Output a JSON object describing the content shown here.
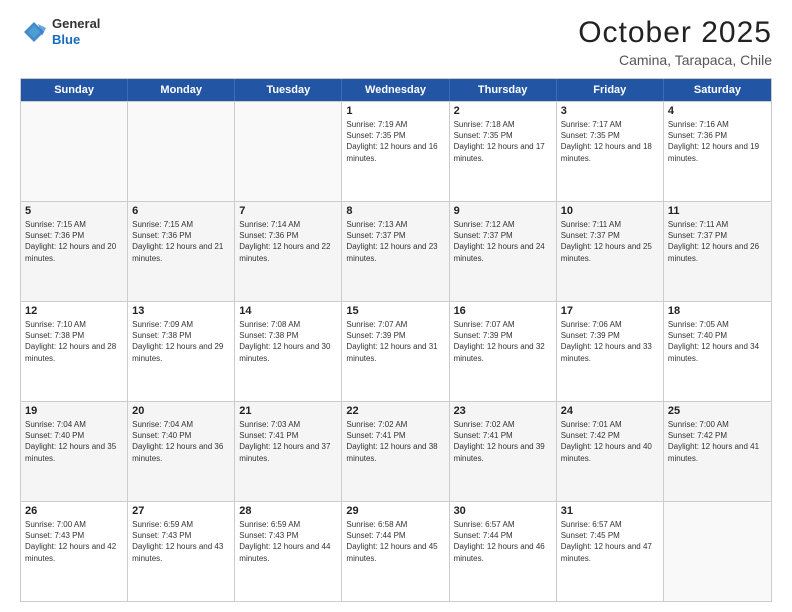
{
  "header": {
    "logo_general": "General",
    "logo_blue": "Blue",
    "month": "October 2025",
    "location": "Camina, Tarapaca, Chile"
  },
  "days_of_week": [
    "Sunday",
    "Monday",
    "Tuesday",
    "Wednesday",
    "Thursday",
    "Friday",
    "Saturday"
  ],
  "rows": [
    [
      {
        "day": "",
        "info": ""
      },
      {
        "day": "",
        "info": ""
      },
      {
        "day": "",
        "info": ""
      },
      {
        "day": "1",
        "info": "Sunrise: 7:19 AM\nSunset: 7:35 PM\nDaylight: 12 hours and 16 minutes."
      },
      {
        "day": "2",
        "info": "Sunrise: 7:18 AM\nSunset: 7:35 PM\nDaylight: 12 hours and 17 minutes."
      },
      {
        "day": "3",
        "info": "Sunrise: 7:17 AM\nSunset: 7:35 PM\nDaylight: 12 hours and 18 minutes."
      },
      {
        "day": "4",
        "info": "Sunrise: 7:16 AM\nSunset: 7:36 PM\nDaylight: 12 hours and 19 minutes."
      }
    ],
    [
      {
        "day": "5",
        "info": "Sunrise: 7:15 AM\nSunset: 7:36 PM\nDaylight: 12 hours and 20 minutes."
      },
      {
        "day": "6",
        "info": "Sunrise: 7:15 AM\nSunset: 7:36 PM\nDaylight: 12 hours and 21 minutes."
      },
      {
        "day": "7",
        "info": "Sunrise: 7:14 AM\nSunset: 7:36 PM\nDaylight: 12 hours and 22 minutes."
      },
      {
        "day": "8",
        "info": "Sunrise: 7:13 AM\nSunset: 7:37 PM\nDaylight: 12 hours and 23 minutes."
      },
      {
        "day": "9",
        "info": "Sunrise: 7:12 AM\nSunset: 7:37 PM\nDaylight: 12 hours and 24 minutes."
      },
      {
        "day": "10",
        "info": "Sunrise: 7:11 AM\nSunset: 7:37 PM\nDaylight: 12 hours and 25 minutes."
      },
      {
        "day": "11",
        "info": "Sunrise: 7:11 AM\nSunset: 7:37 PM\nDaylight: 12 hours and 26 minutes."
      }
    ],
    [
      {
        "day": "12",
        "info": "Sunrise: 7:10 AM\nSunset: 7:38 PM\nDaylight: 12 hours and 28 minutes."
      },
      {
        "day": "13",
        "info": "Sunrise: 7:09 AM\nSunset: 7:38 PM\nDaylight: 12 hours and 29 minutes."
      },
      {
        "day": "14",
        "info": "Sunrise: 7:08 AM\nSunset: 7:38 PM\nDaylight: 12 hours and 30 minutes."
      },
      {
        "day": "15",
        "info": "Sunrise: 7:07 AM\nSunset: 7:39 PM\nDaylight: 12 hours and 31 minutes."
      },
      {
        "day": "16",
        "info": "Sunrise: 7:07 AM\nSunset: 7:39 PM\nDaylight: 12 hours and 32 minutes."
      },
      {
        "day": "17",
        "info": "Sunrise: 7:06 AM\nSunset: 7:39 PM\nDaylight: 12 hours and 33 minutes."
      },
      {
        "day": "18",
        "info": "Sunrise: 7:05 AM\nSunset: 7:40 PM\nDaylight: 12 hours and 34 minutes."
      }
    ],
    [
      {
        "day": "19",
        "info": "Sunrise: 7:04 AM\nSunset: 7:40 PM\nDaylight: 12 hours and 35 minutes."
      },
      {
        "day": "20",
        "info": "Sunrise: 7:04 AM\nSunset: 7:40 PM\nDaylight: 12 hours and 36 minutes."
      },
      {
        "day": "21",
        "info": "Sunrise: 7:03 AM\nSunset: 7:41 PM\nDaylight: 12 hours and 37 minutes."
      },
      {
        "day": "22",
        "info": "Sunrise: 7:02 AM\nSunset: 7:41 PM\nDaylight: 12 hours and 38 minutes."
      },
      {
        "day": "23",
        "info": "Sunrise: 7:02 AM\nSunset: 7:41 PM\nDaylight: 12 hours and 39 minutes."
      },
      {
        "day": "24",
        "info": "Sunrise: 7:01 AM\nSunset: 7:42 PM\nDaylight: 12 hours and 40 minutes."
      },
      {
        "day": "25",
        "info": "Sunrise: 7:00 AM\nSunset: 7:42 PM\nDaylight: 12 hours and 41 minutes."
      }
    ],
    [
      {
        "day": "26",
        "info": "Sunrise: 7:00 AM\nSunset: 7:43 PM\nDaylight: 12 hours and 42 minutes."
      },
      {
        "day": "27",
        "info": "Sunrise: 6:59 AM\nSunset: 7:43 PM\nDaylight: 12 hours and 43 minutes."
      },
      {
        "day": "28",
        "info": "Sunrise: 6:59 AM\nSunset: 7:43 PM\nDaylight: 12 hours and 44 minutes."
      },
      {
        "day": "29",
        "info": "Sunrise: 6:58 AM\nSunset: 7:44 PM\nDaylight: 12 hours and 45 minutes."
      },
      {
        "day": "30",
        "info": "Sunrise: 6:57 AM\nSunset: 7:44 PM\nDaylight: 12 hours and 46 minutes."
      },
      {
        "day": "31",
        "info": "Sunrise: 6:57 AM\nSunset: 7:45 PM\nDaylight: 12 hours and 47 minutes."
      },
      {
        "day": "",
        "info": ""
      }
    ]
  ]
}
